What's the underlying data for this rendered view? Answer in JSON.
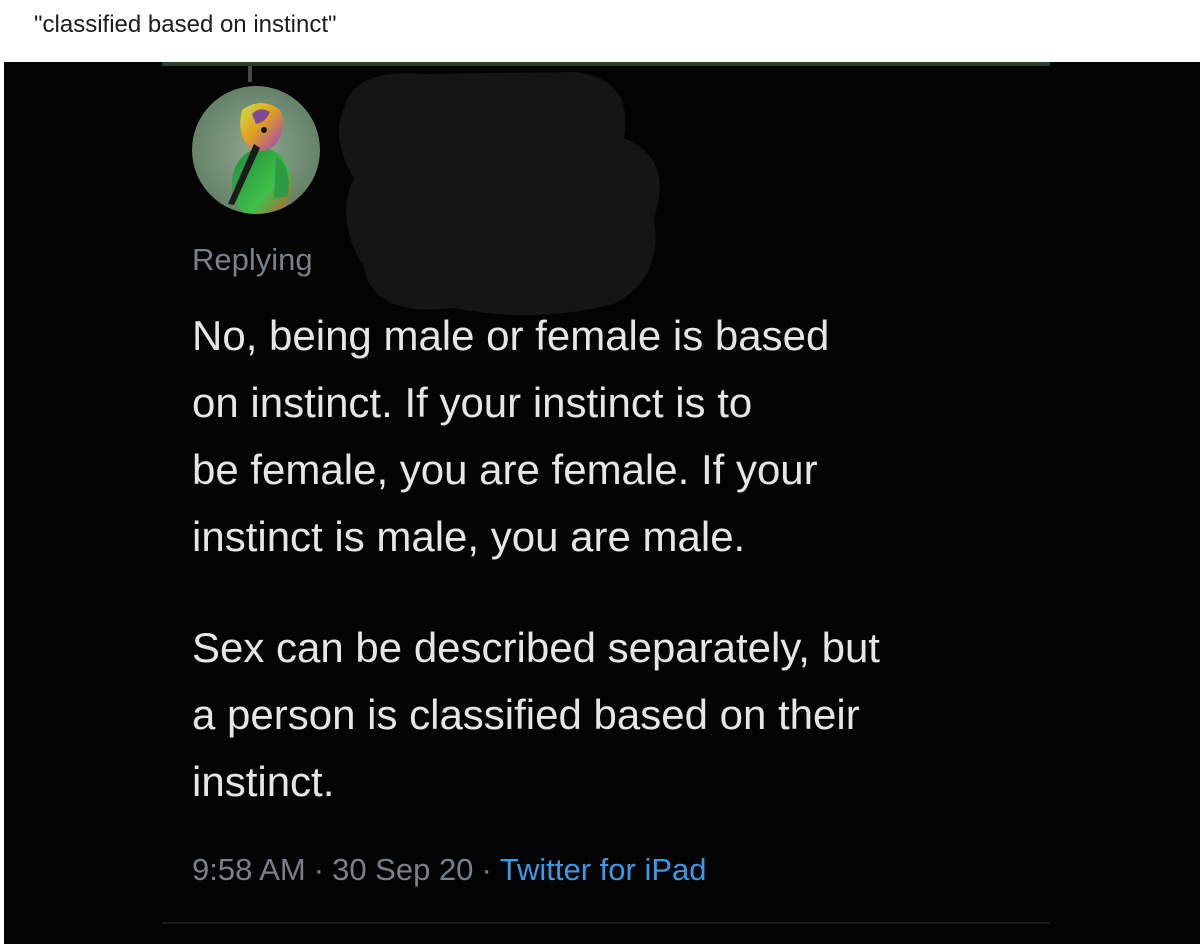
{
  "post": {
    "caption": "\"classified based on instinct\""
  },
  "tweet": {
    "reply_prefix": "Replying",
    "paragraphs": [
      "No, being male or female is based\non instinct.  If your instinct is to\nbe female, you are female.  If your\ninstinct is male, you are male.",
      "Sex can be described separately, but\na person is classified based on their\ninstinct."
    ],
    "time": "9:58 AM",
    "date": "30 Sep 20",
    "source": "Twitter for iPad",
    "separator": "·",
    "avatar_icon": "hummingbird-avatar",
    "colors": {
      "background": "#030303",
      "text": "#e6e6e6",
      "muted": "#7a8087",
      "link": "#3a9ae8"
    }
  }
}
